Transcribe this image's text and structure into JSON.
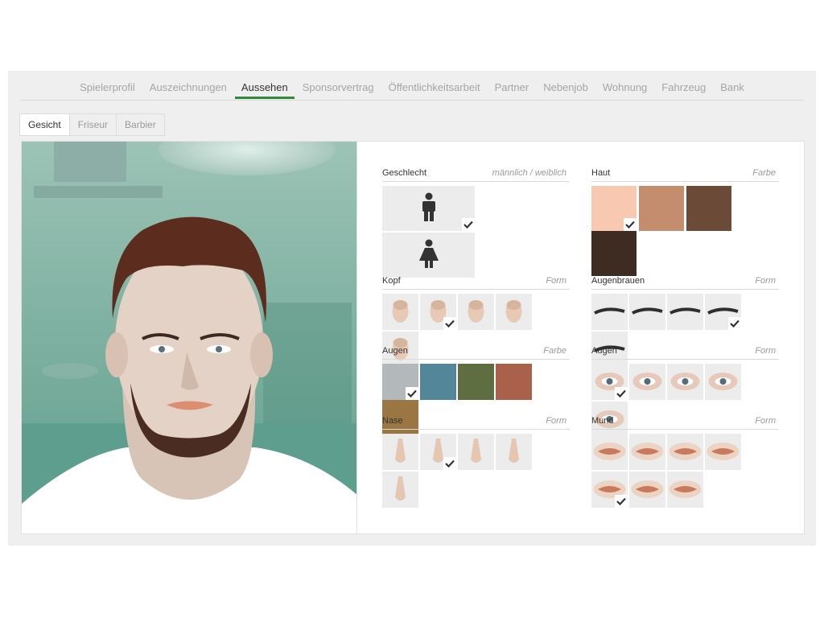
{
  "main_tabs": [
    {
      "label": "Spielerprofil",
      "active": false
    },
    {
      "label": "Auszeichnungen",
      "active": false
    },
    {
      "label": "Aussehen",
      "active": true
    },
    {
      "label": "Sponsorvertrag",
      "active": false
    },
    {
      "label": "Öffentlichkeitsarbeit",
      "active": false
    },
    {
      "label": "Partner",
      "active": false
    },
    {
      "label": "Nebenjob",
      "active": false
    },
    {
      "label": "Wohnung",
      "active": false
    },
    {
      "label": "Fahrzeug",
      "active": false
    },
    {
      "label": "Bank",
      "active": false
    }
  ],
  "sub_tabs": [
    {
      "label": "Gesicht",
      "active": true
    },
    {
      "label": "Friseur",
      "active": false
    },
    {
      "label": "Barbier",
      "active": false
    }
  ],
  "accent_color": "#2e8b3a",
  "sections": {
    "geschlecht": {
      "title": "Geschlecht",
      "hint": "männlich / weiblich",
      "options": [
        "male-icon",
        "female-icon"
      ],
      "selected": 0
    },
    "haut": {
      "title": "Haut",
      "hint": "Farbe",
      "colors": [
        "#f9c8b0",
        "#c48e6e",
        "#6b4a38",
        "#3e2b21"
      ],
      "selected": 0
    },
    "kopf": {
      "title": "Kopf",
      "hint": "Form",
      "count": 5,
      "selected": 1
    },
    "augenbrauen": {
      "title": "Augenbrauen",
      "hint": "Form",
      "count": 5,
      "selected": 3
    },
    "augen_farbe": {
      "title": "Augen",
      "hint": "Farbe",
      "colors": [
        "#b3b8bb",
        "#54869a",
        "#5f6e40",
        "#a9614c",
        "#9c7642"
      ],
      "selected": 0
    },
    "augen_form": {
      "title": "Augen",
      "hint": "Form",
      "count": 5,
      "selected": 0
    },
    "nase": {
      "title": "Nase",
      "hint": "Form",
      "count": 5,
      "selected": 1
    },
    "mund": {
      "title": "Mund",
      "hint": "Form",
      "count": 7,
      "selected": 4
    }
  }
}
